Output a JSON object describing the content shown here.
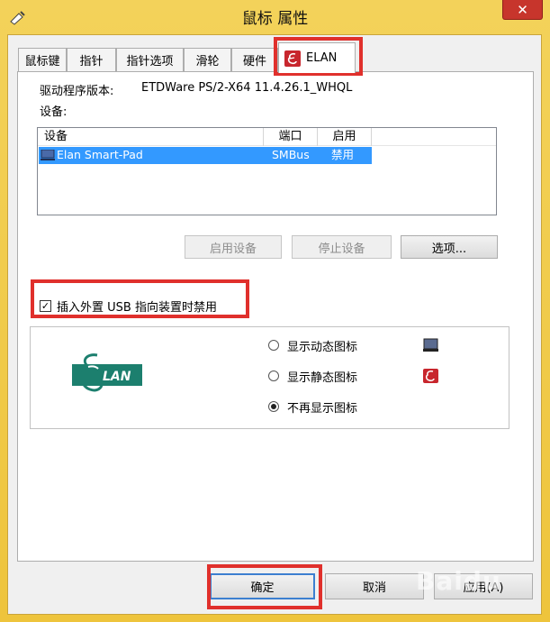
{
  "window": {
    "title": "鼠标 属性",
    "close_glyph": "✕"
  },
  "tabs": [
    {
      "label": "鼠标键"
    },
    {
      "label": "指针"
    },
    {
      "label": "指针选项"
    },
    {
      "label": "滑轮"
    },
    {
      "label": "硬件"
    },
    {
      "label": "ELAN",
      "icon": "elan-logo-icon",
      "active": true
    }
  ],
  "driver": {
    "label": "驱动程序版本:",
    "value": "ETDWare PS/2-X64 11.4.26.1_WHQL"
  },
  "devices": {
    "label": "设备:",
    "columns": [
      "设备",
      "端口",
      "启用"
    ],
    "rows": [
      {
        "name": "Elan Smart-Pad",
        "port": "SMBus",
        "enabled": "禁用",
        "selected": true
      }
    ]
  },
  "buttons": {
    "enable": "启用设备",
    "stop": "停止设备",
    "options": "选项..."
  },
  "usb_disable": {
    "label": "插入外置 USB 指向装置时禁用",
    "checked": true,
    "check_glyph": "✓"
  },
  "icon_options": [
    {
      "label": "显示动态图标",
      "selected": false,
      "icon": "monitor-icon"
    },
    {
      "label": "显示静态图标",
      "selected": false,
      "icon": "elan-logo-icon"
    },
    {
      "label": "不再显示图标",
      "selected": true
    }
  ],
  "logo": {
    "text": "LAN",
    "letter": "E"
  },
  "footer": {
    "ok": "确定",
    "cancel": "取消",
    "apply": "应用(A)"
  },
  "watermark": "Baidu",
  "colors": {
    "title_bar": "#f3d25a",
    "selection": "#3399ff",
    "highlight_box": "#e0302c",
    "logo_teal": "#1c7f6e"
  }
}
